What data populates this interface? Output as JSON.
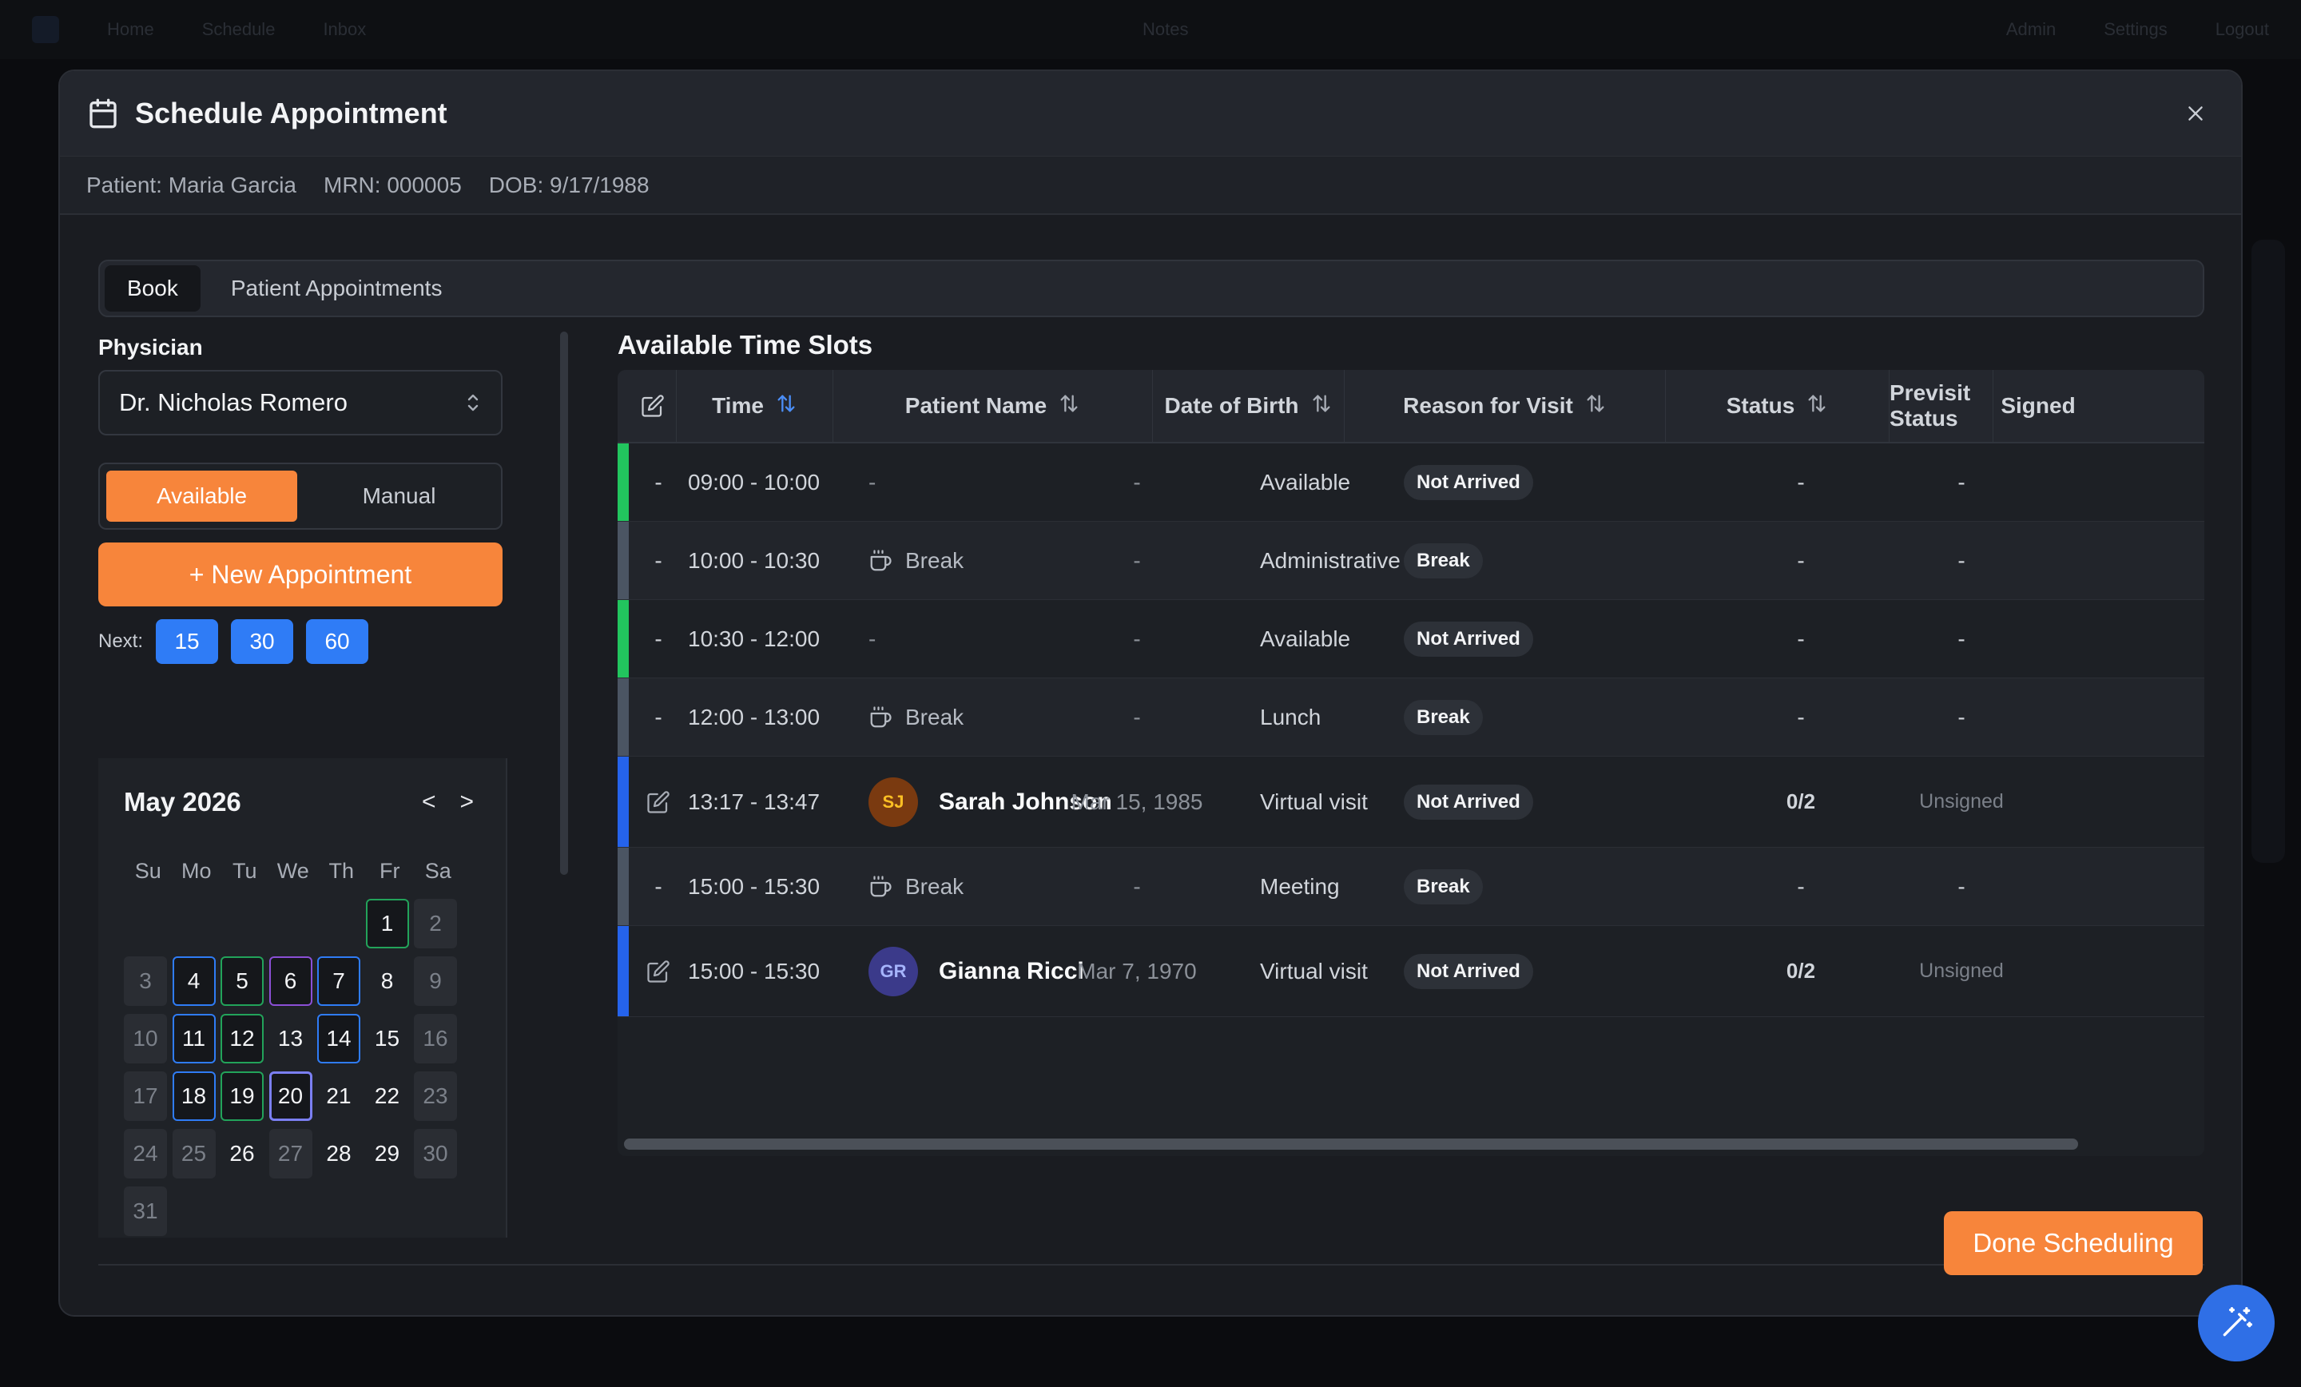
{
  "background": {
    "nav": [
      "Home",
      "Schedule",
      "Inbox"
    ],
    "center": "Notes",
    "right": [
      "Admin",
      "Settings",
      "Logout"
    ]
  },
  "modal": {
    "title": "Schedule Appointment",
    "patient": {
      "patient_label": "Patient:",
      "patient_value": "Maria Garcia",
      "mrn_label": "MRN:",
      "mrn_value": "000005",
      "dob_label": "DOB:",
      "dob_value": "9/17/1988"
    },
    "tabs": [
      {
        "label": "Book",
        "active": true
      },
      {
        "label": "Patient Appointments",
        "active": false
      }
    ],
    "physician": {
      "label": "Physician",
      "selected": "Dr. Nicholas Romero"
    },
    "mode": {
      "available": "Available",
      "manual": "Manual",
      "active": "Available"
    },
    "new_appointment": "+ New Appointment",
    "next": {
      "label": "Next:",
      "options": [
        "15",
        "30",
        "60"
      ]
    },
    "calendar": {
      "month": "May 2026",
      "prev": "<",
      "next": ">",
      "weekdays": [
        "Su",
        "Mo",
        "Tu",
        "We",
        "Th",
        "Fr",
        "Sa"
      ],
      "days": [
        {
          "d": "",
          "s": "empty"
        },
        {
          "d": "",
          "s": "empty"
        },
        {
          "d": "",
          "s": "empty"
        },
        {
          "d": "",
          "s": "empty"
        },
        {
          "d": "",
          "s": "empty"
        },
        {
          "d": "1",
          "s": "green"
        },
        {
          "d": "2",
          "s": "muted"
        },
        {
          "d": "3",
          "s": "muted"
        },
        {
          "d": "4",
          "s": "blue"
        },
        {
          "d": "5",
          "s": "green"
        },
        {
          "d": "6",
          "s": "purple"
        },
        {
          "d": "7",
          "s": "blue"
        },
        {
          "d": "8",
          "s": ""
        },
        {
          "d": "9",
          "s": "muted"
        },
        {
          "d": "10",
          "s": "muted"
        },
        {
          "d": "11",
          "s": "blue"
        },
        {
          "d": "12",
          "s": "green"
        },
        {
          "d": "13",
          "s": ""
        },
        {
          "d": "14",
          "s": "blue"
        },
        {
          "d": "15",
          "s": ""
        },
        {
          "d": "16",
          "s": "muted"
        },
        {
          "d": "17",
          "s": "muted"
        },
        {
          "d": "18",
          "s": "blue"
        },
        {
          "d": "19",
          "s": "green"
        },
        {
          "d": "20",
          "s": "selected"
        },
        {
          "d": "21",
          "s": ""
        },
        {
          "d": "22",
          "s": ""
        },
        {
          "d": "23",
          "s": "muted"
        },
        {
          "d": "24",
          "s": "muted"
        },
        {
          "d": "25",
          "s": "muted"
        },
        {
          "d": "26",
          "s": ""
        },
        {
          "d": "27",
          "s": "muted"
        },
        {
          "d": "28",
          "s": ""
        },
        {
          "d": "29",
          "s": ""
        },
        {
          "d": "30",
          "s": "muted"
        },
        {
          "d": "31",
          "s": "muted"
        }
      ]
    },
    "slots": {
      "title": "Available Time Slots",
      "columns": [
        "Time",
        "Patient Name",
        "Date of Birth",
        "Reason for Visit",
        "Status",
        "Previsit Status",
        "Signed"
      ],
      "rows": [
        {
          "bar": "#22c55e",
          "edit": false,
          "time": "09:00 - 10:00",
          "patient": "-",
          "kind": "empty",
          "dob": "-",
          "reason": "Available",
          "status": "Not Arrived",
          "previsit": "-",
          "signed": "-"
        },
        {
          "bar": "#4b5563",
          "edit": false,
          "time": "10:00 - 10:30",
          "patient": "Break",
          "kind": "break",
          "dob": "-",
          "reason": "Administrative",
          "status": "Break",
          "previsit": "-",
          "signed": "-"
        },
        {
          "bar": "#22c55e",
          "edit": false,
          "time": "10:30 - 12:00",
          "patient": "-",
          "kind": "empty",
          "dob": "-",
          "reason": "Available",
          "status": "Not Arrived",
          "previsit": "-",
          "signed": "-"
        },
        {
          "bar": "#4b5563",
          "edit": false,
          "time": "12:00 - 13:00",
          "patient": "Break",
          "kind": "break",
          "dob": "-",
          "reason": "Lunch",
          "status": "Break",
          "previsit": "-",
          "signed": "-"
        },
        {
          "bar": "#2563eb",
          "edit": true,
          "time": "13:17 - 13:47",
          "patient": "Sarah Johnson",
          "initials": "SJ",
          "avatar_bg": "#7a3a10",
          "avatar_fg": "#fbbf24",
          "kind": "patient",
          "dob": "Mar 15, 1985",
          "reason": "Virtual visit",
          "status": "Not Arrived",
          "previsit": "0/2",
          "signed": "Unsigned"
        },
        {
          "bar": "#4b5563",
          "edit": false,
          "time": "15:00 - 15:30",
          "patient": "Break",
          "kind": "break",
          "dob": "-",
          "reason": "Meeting",
          "status": "Break",
          "previsit": "-",
          "signed": "-"
        },
        {
          "bar": "#2563eb",
          "edit": true,
          "time": "15:00 - 15:30",
          "patient": "Gianna Ricci",
          "initials": "GR",
          "avatar_bg": "#3b3a8a",
          "avatar_fg": "#a5b4fc",
          "kind": "patient",
          "dob": "Mar 7, 1970",
          "reason": "Virtual visit",
          "status": "Not Arrived",
          "previsit": "0/2",
          "signed": "Unsigned"
        }
      ],
      "empty_dash": "-"
    },
    "done_button": "Done Scheduling"
  },
  "colors": {
    "accent": "#f7853b",
    "primary_blue": "#2f7cf6"
  }
}
